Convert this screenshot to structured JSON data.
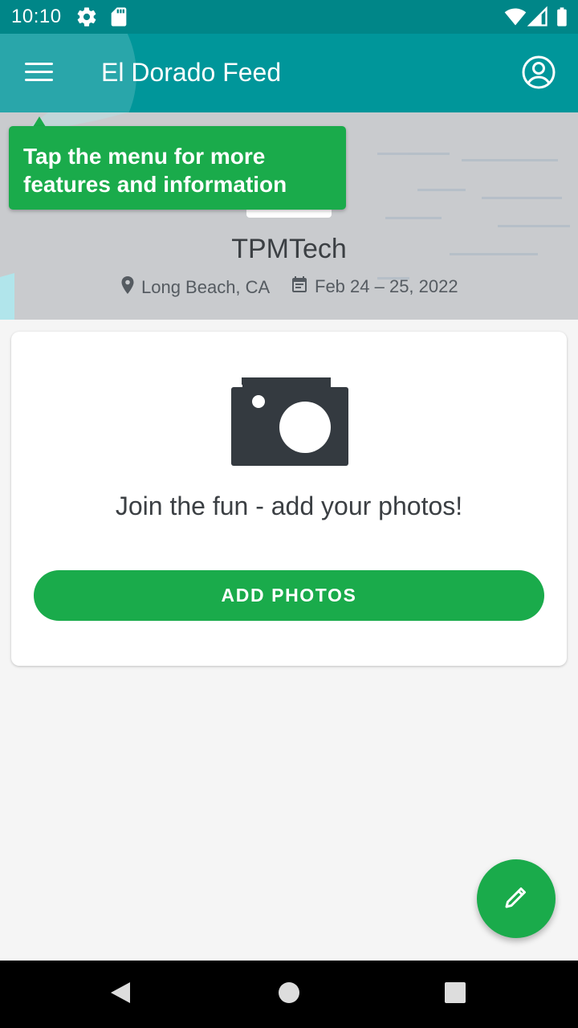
{
  "status_bar": {
    "time": "10:10",
    "icons": [
      "settings-icon",
      "sd-card-icon",
      "wifi-icon",
      "signal-icon",
      "battery-icon"
    ]
  },
  "app_bar": {
    "title": "El Dorado Feed",
    "menu_icon": "menu-icon",
    "account_icon": "account-circle-icon"
  },
  "tooltip": {
    "line1": "Tap the menu for more",
    "line2": "features and information"
  },
  "event": {
    "name": "TPMTech",
    "location": "Long Beach, CA",
    "dates": "Feb 24 – 25, 2022"
  },
  "photo_card": {
    "prompt": "Join the fun - add your photos!",
    "button_label": "ADD PHOTOS"
  },
  "fab": {
    "icon": "edit-pencil-icon"
  },
  "nav_bar": {
    "icons": [
      "back-icon",
      "home-icon",
      "recents-icon"
    ]
  },
  "colors": {
    "status_bar": "#008688",
    "app_bar": "#00969a",
    "accent_green": "#1aab4b",
    "background": "#f5f5f5",
    "text_dark": "#3b3f43"
  }
}
